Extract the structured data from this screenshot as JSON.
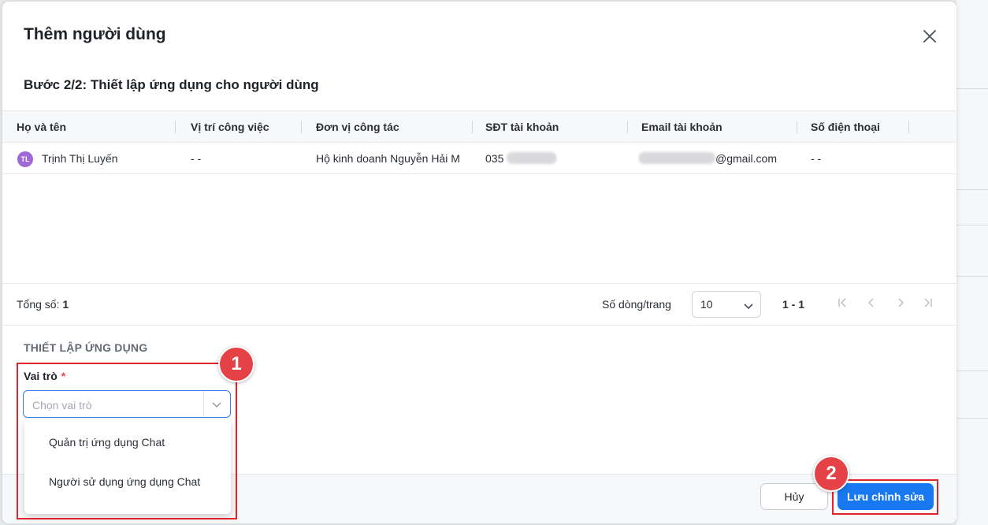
{
  "dialog": {
    "title": "Thêm người dùng",
    "step_title": "Bước 2/2: Thiết lập ứng dụng cho người dùng"
  },
  "table": {
    "columns": [
      "Họ và tên",
      "Vị trí công việc",
      "Đơn vị công tác",
      "SĐT tài khoản",
      "Email tài khoản",
      "Số điện thoại"
    ],
    "rows": [
      {
        "avatar_initials": "TL",
        "name": "Trịnh Thị Luyến",
        "position": "- -",
        "unit": "Hộ kinh doanh Nguyễn Hải M",
        "account_phone": "035",
        "account_email": "@gmail.com",
        "phone": "- -"
      }
    ]
  },
  "pagination": {
    "total_label": "Tổng số:",
    "total_value": "1",
    "rows_per_page_label": "Số dòng/trang",
    "rows_per_page": "10",
    "range": "1 - 1"
  },
  "app_setup": {
    "section_title": "THIẾT LẬP ỨNG DỤNG",
    "role_label": "Vai trò",
    "required_mark": "*",
    "role_placeholder": "Chọn vai trò",
    "role_options": [
      "Quản trị ứng dụng Chat",
      "Người sử dụng ứng dụng Chat"
    ]
  },
  "footer": {
    "cancel_label": "Hủy",
    "save_label": "Lưu chỉnh sửa"
  },
  "annotations": {
    "badge_1": "1",
    "badge_2": "2"
  },
  "colors": {
    "primary": "#1778f2",
    "annotation_red": "#e0242b",
    "avatar": "#9e68d6",
    "required": "#e5484d"
  },
  "icons": [
    "close-icon",
    "chevron-down-icon",
    "first-page-icon",
    "prev-page-icon",
    "next-page-icon",
    "last-page-icon"
  ]
}
